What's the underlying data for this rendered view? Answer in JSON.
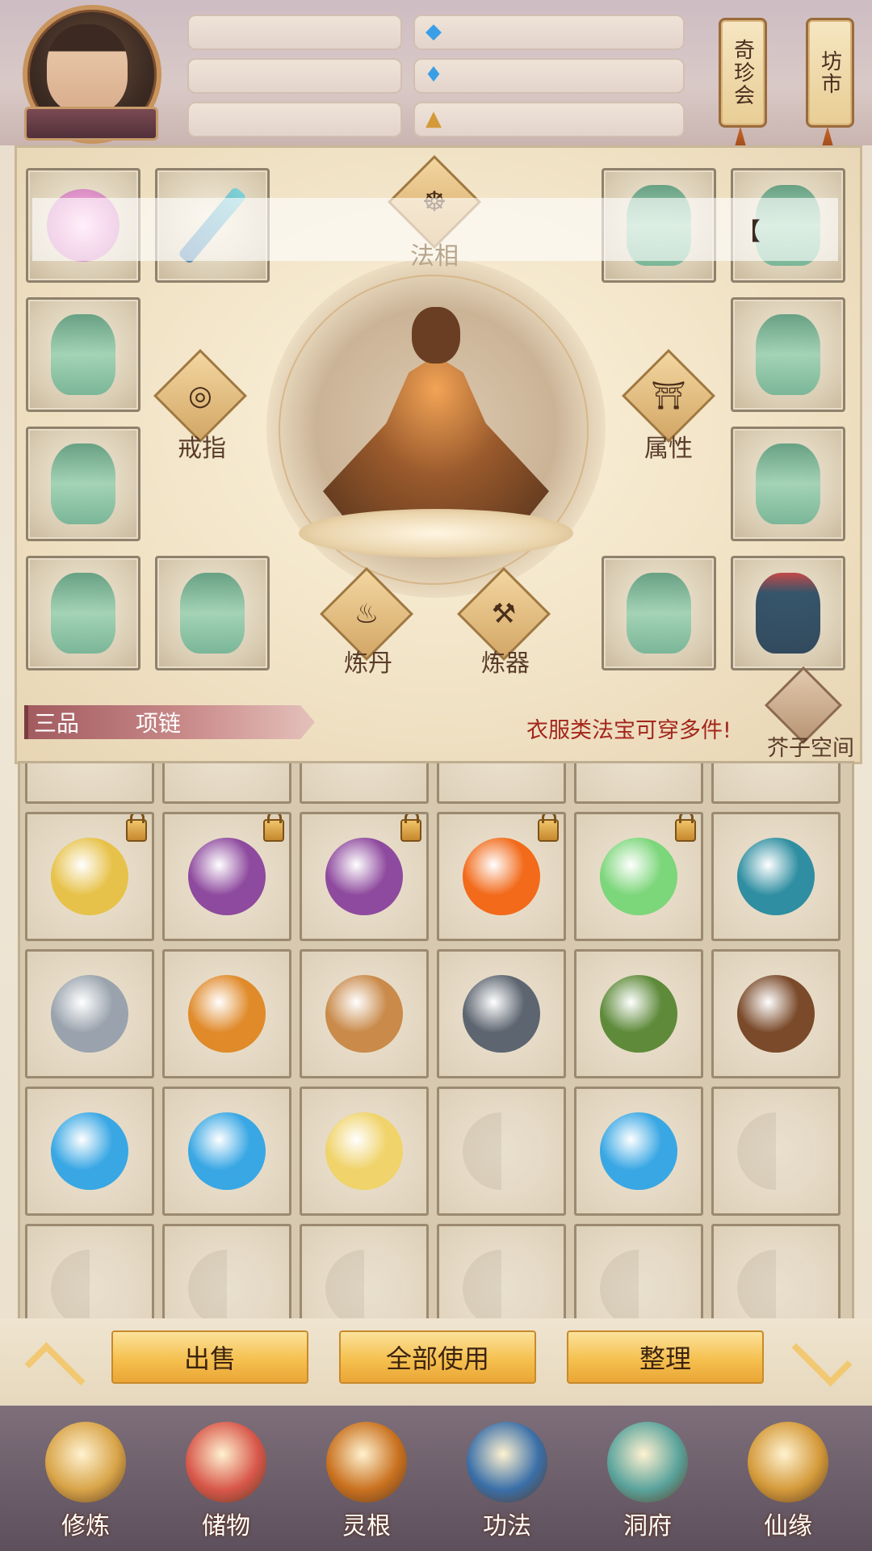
{
  "top": {
    "avatar": "character-portrait",
    "player_name": "",
    "resources_left": [
      "",
      "",
      ""
    ],
    "resources_right": [
      {
        "icon": "blue-crystal-icon",
        "value": ""
      },
      {
        "icon": "spirit-drop-icon",
        "value": ""
      },
      {
        "icon": "meditating-figure-icon",
        "value": ""
      }
    ],
    "shop_buttons": [
      {
        "label": "奇珍会"
      },
      {
        "label": "坊市"
      }
    ]
  },
  "equipment": {
    "center_label": "法相",
    "left_diamond_label": "戒指",
    "right_diamond_label": "属性",
    "bottom_left_label": "炼丹",
    "bottom_right_label": "炼器",
    "overlay_bracket": "【",
    "slots": [
      {
        "item": "pink-orb"
      },
      {
        "item": "sword"
      },
      {
        "item": "jade-robe"
      },
      {
        "item": "jade-robe"
      },
      {
        "item": "jade-robe"
      },
      {
        "item": "jade-robe"
      },
      {
        "item": "jade-robe"
      },
      {
        "item": "jade-robe"
      },
      {
        "item": "jade-robe"
      },
      {
        "item": "jade-robe"
      },
      {
        "item": "jade-robe"
      },
      {
        "item": "dark-robe"
      }
    ]
  },
  "info": {
    "grade": "三品",
    "type": "项链",
    "hint": "衣服类法宝可穿多件!",
    "storage_label": "芥子空间"
  },
  "inventory": {
    "rows": [
      [
        {
          "item": "golden-talisman",
          "locked": true,
          "color": "#e7c24a"
        },
        {
          "item": "purple-thunder-orb",
          "locked": true,
          "color": "#8e4a9e"
        },
        {
          "item": "purple-thunder-orb",
          "locked": true,
          "color": "#8e4a9e"
        },
        {
          "item": "fire-essence",
          "locked": true,
          "color": "#f26a1a"
        },
        {
          "item": "green-spirit-herb",
          "locked": true,
          "color": "#7cd67a"
        },
        {
          "item": "scroll",
          "locked": false,
          "color": "#2f8ea1"
        }
      ],
      [
        {
          "item": "iron-shards",
          "locked": false,
          "color": "#9aa3ad"
        },
        {
          "item": "lotus-pod",
          "locked": false,
          "color": "#e08a2a"
        },
        {
          "item": "ginseng-root",
          "locked": false,
          "color": "#c98a4a"
        },
        {
          "item": "black-ore",
          "locked": false,
          "color": "#5d6570"
        },
        {
          "item": "red-flower-herb",
          "locked": false,
          "color": "#5e8a3a"
        },
        {
          "item": "brown-tuber",
          "locked": false,
          "color": "#7a4a2a"
        }
      ],
      [
        {
          "item": "blue-spirit-stone",
          "locked": false,
          "color": "#39a7e4"
        },
        {
          "item": "blue-spirit-stone",
          "locked": false,
          "color": "#39a7e4"
        },
        {
          "item": "golden-feather",
          "locked": false,
          "color": "#f0d36a"
        },
        {
          "item": "",
          "locked": false,
          "color": ""
        },
        {
          "item": "blue-spirit-stone",
          "locked": false,
          "color": "#39a7e4"
        },
        {
          "item": "",
          "locked": false,
          "color": ""
        }
      ],
      [
        {
          "item": "",
          "locked": false,
          "color": ""
        },
        {
          "item": "",
          "locked": false,
          "color": ""
        },
        {
          "item": "",
          "locked": false,
          "color": ""
        },
        {
          "item": "",
          "locked": false,
          "color": ""
        },
        {
          "item": "",
          "locked": false,
          "color": ""
        },
        {
          "item": "",
          "locked": false,
          "color": ""
        }
      ]
    ]
  },
  "actions": {
    "sell": "出售",
    "use_all": "全部使用",
    "sort": "整理"
  },
  "nav": [
    {
      "label": "修炼",
      "icon": "hooded-monk-icon",
      "color": "#d8a448"
    },
    {
      "label": "储物",
      "icon": "storage-bag-icon",
      "color": "#d8574a"
    },
    {
      "label": "灵根",
      "icon": "spirit-root-icon",
      "color": "#c9711f"
    },
    {
      "label": "功法",
      "icon": "book-icon",
      "color": "#3a6fa8"
    },
    {
      "label": "洞府",
      "icon": "cave-house-icon",
      "color": "#5aa39c"
    },
    {
      "label": "仙缘",
      "icon": "gourd-icon",
      "color": "#d49a3a"
    }
  ]
}
